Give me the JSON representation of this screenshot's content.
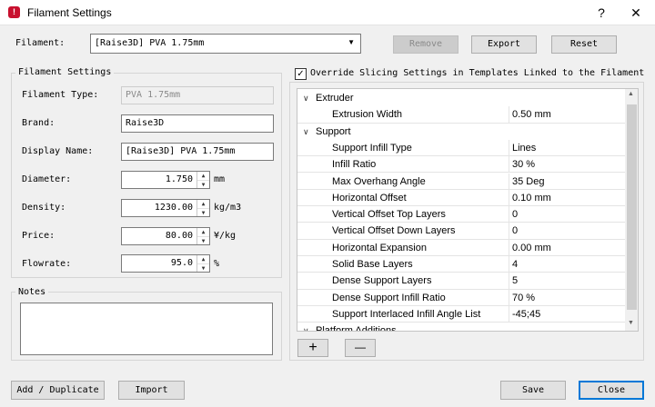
{
  "window": {
    "title": "Filament Settings",
    "help_glyph": "?",
    "close_glyph": "✕"
  },
  "top": {
    "filament_label": "Filament:",
    "filament_selected": "[Raise3D] PVA 1.75mm",
    "remove_label": "Remove",
    "export_label": "Export",
    "reset_label": "Reset"
  },
  "settings": {
    "group_title": "Filament Settings",
    "filament_type_label": "Filament Type:",
    "filament_type_value": "PVA 1.75mm",
    "brand_label": "Brand:",
    "brand_value": "Raise3D",
    "display_name_label": "Display Name:",
    "display_name_value": "[Raise3D] PVA 1.75mm",
    "diameter_label": "Diameter:",
    "diameter_value": "1.750",
    "diameter_unit": "mm",
    "density_label": "Density:",
    "density_value": "1230.00",
    "density_unit": "kg/m3",
    "price_label": "Price:",
    "price_value": "80.00",
    "price_unit": "¥/kg",
    "flowrate_label": "Flowrate:",
    "flowrate_value": "95.0",
    "flowrate_unit": "%"
  },
  "notes": {
    "title": "Notes",
    "value": ""
  },
  "override": {
    "label": "Override Slicing Settings in Templates Linked to the Filament",
    "checked_glyph": "✓"
  },
  "tree": {
    "chevron_down": "∨",
    "chevron_right": "›",
    "rows": [
      {
        "name": "Extruder",
        "value": ""
      },
      {
        "name": "Extrusion Width",
        "value": "0.50 mm"
      },
      {
        "name": "Support",
        "value": ""
      },
      {
        "name": "Support Infill Type",
        "value": "Lines"
      },
      {
        "name": "Infill Ratio",
        "value": "30 %"
      },
      {
        "name": "Max Overhang Angle",
        "value": "35 Deg"
      },
      {
        "name": "Horizontal Offset",
        "value": "0.10 mm"
      },
      {
        "name": "Vertical Offset Top Layers",
        "value": "0"
      },
      {
        "name": "Vertical Offset Down Layers",
        "value": "0"
      },
      {
        "name": "Horizontal Expansion",
        "value": "0.00 mm"
      },
      {
        "name": "Solid Base Layers",
        "value": "4"
      },
      {
        "name": "Dense Support Layers",
        "value": "5"
      },
      {
        "name": "Dense Support Infill Ratio",
        "value": "70 %"
      },
      {
        "name": "Support Interlaced Infill Angle List",
        "value": "-45;45"
      },
      {
        "name": "Platform Additions",
        "value": ""
      }
    ],
    "add_glyph": "+",
    "remove_glyph": "—"
  },
  "bottom": {
    "add_duplicate_label": "Add / Duplicate",
    "import_label": "Import",
    "save_label": "Save",
    "close_label": "Close"
  }
}
